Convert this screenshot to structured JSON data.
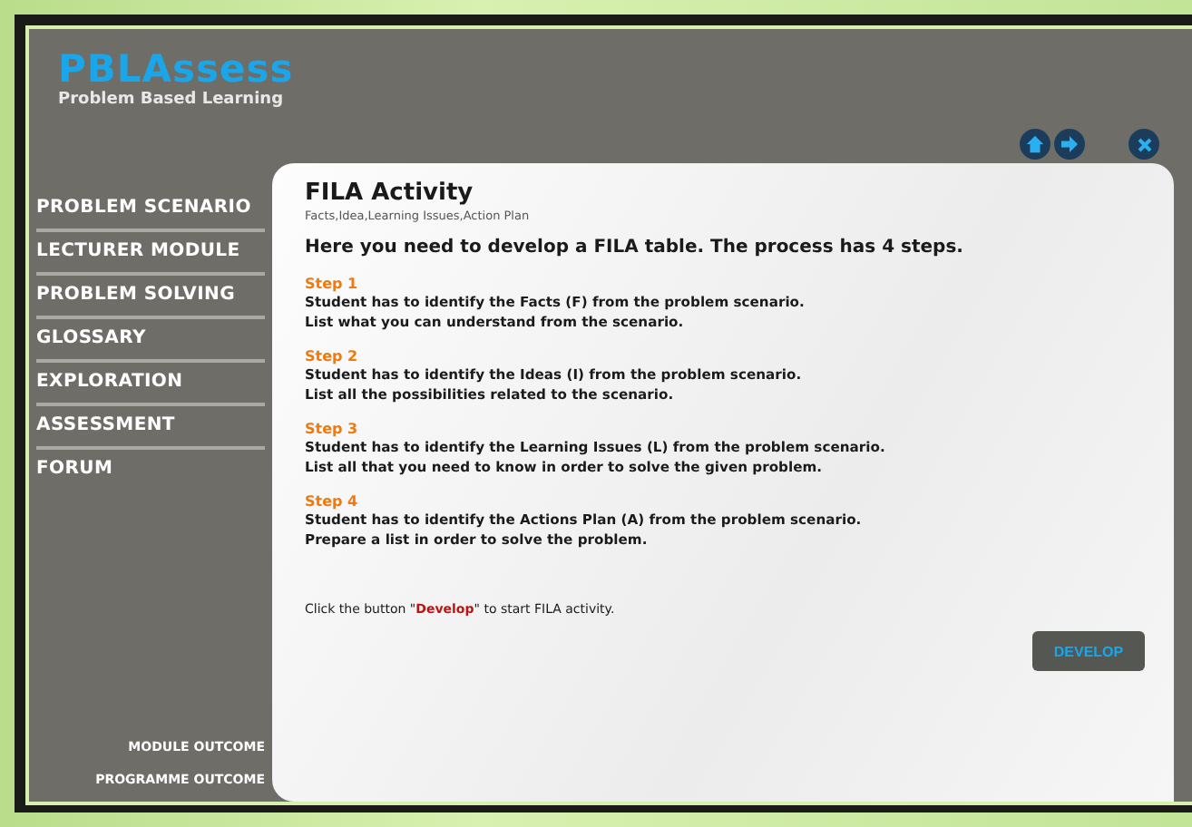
{
  "brand": {
    "name": "PBLAssess",
    "tagline": "Problem Based Learning"
  },
  "sidebar": {
    "items": [
      {
        "label": "PROBLEM SCENARIO"
      },
      {
        "label": "LECTURER MODULE"
      },
      {
        "label": "PROBLEM SOLVING"
      },
      {
        "label": "GLOSSARY"
      },
      {
        "label": "EXPLORATION"
      },
      {
        "label": "ASSESSMENT"
      },
      {
        "label": "FORUM"
      }
    ],
    "footer_links": [
      "MODULE OUTCOME",
      "PROGRAMME OUTCOME"
    ]
  },
  "toolbar": [
    {
      "kind": "home"
    },
    {
      "kind": "next"
    },
    {
      "kind": "close"
    }
  ],
  "content": {
    "title": "FILA Activity",
    "subtitle": "Facts,Idea,Learning Issues,Action Plan",
    "intro": "Here you need to develop a FILA table. The process has 4 steps.",
    "steps": [
      {
        "label": "Step 1",
        "lines": [
          "Student has to identify the Facts (**F**) from the problem scenario.",
          "List what you can understand from the scenario."
        ]
      },
      {
        "label": "Step 2",
        "lines": [
          "Student has to identify the Ideas (**I**) from the problem scenario.",
          "List all the possibilities related to the scenario."
        ]
      },
      {
        "label": "Step 3",
        "lines": [
          "Student has to identify the Learning Issues (**L**) from the problem scenario.",
          "List all that you need to know in order to solve the given problem."
        ]
      },
      {
        "label": "Step 4",
        "lines": [
          "Student has to identify  the Actions Plan (**A**) from the problem scenario.",
          "Prepare a list in order to solve the problem."
        ]
      }
    ],
    "instruction": {
      "before": "Click the button \"",
      "highlight": "Develop",
      "after": "\" to start FILA activity."
    },
    "button": "DEVELOP"
  }
}
